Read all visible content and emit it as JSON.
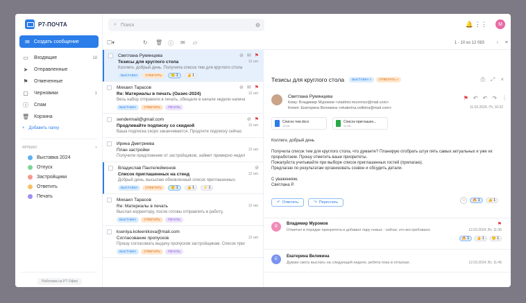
{
  "app": {
    "logo_text": "Р7-ПОЧТА",
    "compose_label": "Создать сообщение",
    "avatar_letter": "М"
  },
  "search": {
    "placeholder": "Поиск"
  },
  "nav": [
    {
      "label": "Входящие",
      "count": "18",
      "icon": "inbox-icon"
    },
    {
      "label": "Отправленные",
      "count": "",
      "icon": "send-icon"
    },
    {
      "label": "Отмеченные",
      "count": "",
      "icon": "flag-icon"
    },
    {
      "label": "Черновики",
      "count": "1",
      "icon": "draft-icon"
    },
    {
      "label": "Спам",
      "count": "",
      "icon": "spam-icon"
    },
    {
      "label": "Корзина",
      "count": "",
      "icon": "trash-icon"
    }
  ],
  "add_folder_label": "Добавить папку",
  "labels_heading": "ЯРЛЫКИ",
  "labels": [
    {
      "label": "Выставка 2024",
      "color": "#5fb0f0"
    },
    {
      "label": "Отпуск",
      "color": "#7fd49a"
    },
    {
      "label": "Застройщики",
      "color": "#f59a8f"
    },
    {
      "label": "Ответить",
      "color": "#f7c267"
    },
    {
      "label": "Печать",
      "color": "#a08ff0"
    }
  ],
  "footer": "Работаем на Р7-Офис",
  "toolbar": {
    "range": "1 - 10 из 12 083"
  },
  "messages": [
    {
      "from": "Светлана Румянцева",
      "subject": "Тезисы для круглого стола",
      "preview": "Коллеги, добрый день. Получила список тем для круглого стола",
      "date": "12 окт.",
      "tags": [
        {
          "t": "ВЫСТАВКА",
          "c": "b"
        },
        {
          "t": "ОТВЕТИТЬ",
          "c": "o"
        }
      ],
      "reactions": [
        "🙂 1",
        "👍 1"
      ],
      "selected": true,
      "icons": "📎 ✉",
      "flag": true
    },
    {
      "from": "Михаил Тарасов",
      "subject": "Re: Материалы в печать (Оазис-2024)",
      "preview": "Весь набор отправили в печать, обещали в начале недели напечатать",
      "date": "12 окт.",
      "tags": [
        {
          "t": "ВЫСТАВКА",
          "c": "b"
        },
        {
          "t": "ОТВЕТИТЬ",
          "c": "o"
        },
        {
          "t": "ПЕЧАТЬ",
          "c": "p"
        }
      ],
      "reactions": [],
      "selected": false,
      "icons": "📎 ✉",
      "flag": true
    },
    {
      "from": "sendermail@gmail.com",
      "subject": "Продлевайте подписку со скидкой",
      "preview": "Ваша подписка скоро заканчивается. Продлите подписку сейчас",
      "date": "12 окт.",
      "tags": [],
      "reactions": [],
      "selected": false,
      "icons": "📎",
      "flag": true
    },
    {
      "from": "Ирина Дмитриева",
      "subject": "План застройки",
      "preview": "Получили предложение от застройщиков, займет примерно неделю",
      "date": "12 окт.",
      "tags": [],
      "reactions": [],
      "selected": false,
      "icons": "",
      "flag": false
    },
    {
      "from": "Владислав Пантелеймонов",
      "subject": "Список приглашенных на стенд",
      "preview": "Добрый день, высылаю обновленный список приглашенных.",
      "date": "12 окт.",
      "tags": [
        {
          "t": "ВЫСТАВКА",
          "c": "b"
        },
        {
          "t": "ОТВЕТИТЬ",
          "c": "o"
        }
      ],
      "reactions": [
        "🙂 1",
        "👍 1",
        "⚡ 1"
      ],
      "selected": false,
      "icons": "📎",
      "flag": false,
      "unread": true
    },
    {
      "from": "Михаил Тарасов",
      "subject": "Re: Материалы в печать",
      "preview": "Выслал корректору, после готовы отправлять в работу.",
      "date": "12 окт.",
      "tags": [
        {
          "t": "ВЫСТАВКА",
          "c": "b"
        },
        {
          "t": "ОТВЕТИТЬ",
          "c": "o"
        },
        {
          "t": "ПЕЧАТЬ",
          "c": "p"
        }
      ],
      "reactions": [],
      "selected": false,
      "icons": "",
      "flag": false
    },
    {
      "from": "kseniya.koleenikova@mail.com",
      "subject": "Согласование пропусков",
      "preview": "Прошу согласовать выдачу пропусков застройщикам. Список прилагаю",
      "date": "12 окт.",
      "tags": [
        {
          "t": "ВЫСТАВКА",
          "c": "b"
        },
        {
          "t": "ОТВЕТИТЬ",
          "c": "o"
        },
        {
          "t": "ПЕЧАТЬ",
          "c": "p"
        }
      ],
      "reactions": [],
      "selected": false,
      "icons": "",
      "flag": false
    }
  ],
  "reading": {
    "title": "Тезисы для круглого стола",
    "tags": [
      {
        "t": "ВЫСТАВКА ×",
        "c": "b"
      },
      {
        "t": "ОТВЕТИТЬ ×",
        "c": "o"
      }
    ],
    "sender": "Светлана Румянцева",
    "to": "Кому:  Владимир Муромов <vladimir.muromov@mail.com>",
    "cc": "Копия:  Екатерина Великина <ekaterina.velikina@mail.com>",
    "date": "11.03.2024, Пт, 16:32",
    "attachments": [
      {
        "name": "Список тем.docx",
        "size": "13 КБ",
        "color": "#2b7de9"
      },
      {
        "name": "Список приглашен...",
        "size": "24 КБ",
        "color": "#28a745"
      }
    ],
    "body": [
      "Коллеги, добрый день",
      "Получила список тем для круглого стола, что думаете?  Планирую отобрать штук пять самых актуальных и уже их проработаем. Прошу отметить ваши приоритеты.\nПожалуйста учитывайте при выборе список приглашенных гостей (прилагаю).\nПредлагаю по результатам организовать созвон и обсудить детали.",
      "С уважением,\nСветлана Р."
    ],
    "reply_label": "Ответить",
    "forward_label": "Переслать",
    "reactions": [
      "🔥 1",
      "👍 1"
    ]
  },
  "thread": [
    {
      "letter": "В",
      "color": "#f08ab8",
      "name": "Владимир Муромов",
      "preview": "Отметил в порядке приоритета и добавил пару новых : сейчас это востребовано",
      "date": "12.03.2024, Вт, 11:35",
      "flag": true,
      "reactions": [
        "🔥 1",
        "👍 1",
        "🙂 1"
      ]
    },
    {
      "letter": "Е",
      "color": "#7a93ef",
      "name": "Екатерина Великина",
      "preview": "Думаю смогу выслать на следующей неделе, ребята пока в отпусках.",
      "date": "12.03.2024, Вт, 11:45",
      "flag": false,
      "reactions": []
    }
  ]
}
